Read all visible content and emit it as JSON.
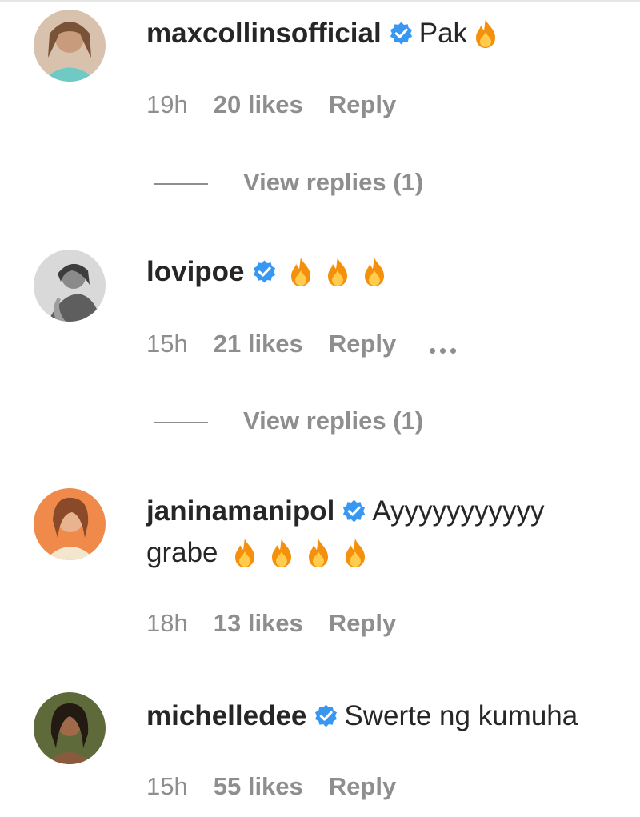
{
  "comments": [
    {
      "username": "maxcollinsofficial",
      "text": "Pak",
      "fires": 1,
      "time": "19h",
      "likes": "20 likes",
      "reply": "Reply",
      "view_replies": "View replies (1)"
    },
    {
      "username": "lovipoe",
      "text": "",
      "fires": 3,
      "time": "15h",
      "likes": "21 likes",
      "reply": "Reply",
      "view_replies": "View replies (1)"
    },
    {
      "username": "janinamanipol",
      "text": "Ayyyyyyyyyyy",
      "text_line2": "grabe",
      "fires": 4,
      "time": "18h",
      "likes": "13 likes",
      "reply": "Reply"
    },
    {
      "username": "michelledee",
      "text": "Swerte ng kumuha",
      "time": "15h",
      "likes": "55 likes",
      "reply": "Reply"
    }
  ],
  "icons": {
    "verified": "verified-badge-icon",
    "fire": "fire-emoji-icon",
    "more": "more-options-icon"
  },
  "colors": {
    "verified": "#3897f0",
    "muted": "#8e8e8e",
    "text": "#262626"
  }
}
